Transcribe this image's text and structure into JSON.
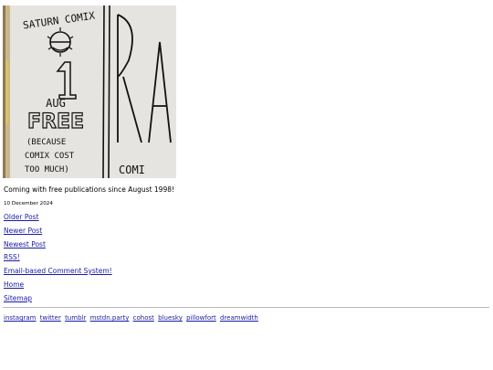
{
  "banner": {
    "top_text": "SATURN COMIX",
    "number": "1",
    "month": "AUG",
    "free": "FREE",
    "note_lines": [
      "(BECAUSE",
      "COMIX COST",
      "TOO MUCH)"
    ],
    "right_panel_text": "COMI",
    "right_panel_big": "RA"
  },
  "tagline": "Coming with free publications since August 1998!",
  "date": "10 December 2024",
  "nav": [
    "Older Post",
    "Newer Post",
    "Newest Post",
    "RSS!",
    "Email-based Comment System!",
    "Home",
    "Sitemap"
  ],
  "social": [
    "instagram",
    "twitter",
    "tumblr",
    "mstdn.party",
    "cohost",
    "bluesky",
    "pillowfort",
    "dreamwidth"
  ],
  "colors": {
    "link": "#1a1aa6",
    "banner_bg": "#e4e2de",
    "rule": "#b8b8b8"
  }
}
